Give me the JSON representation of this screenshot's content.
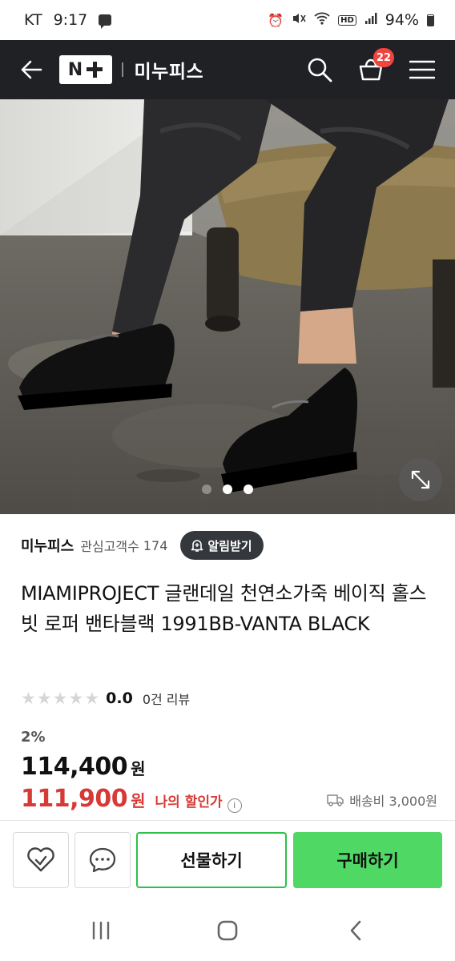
{
  "status_bar": {
    "carrier": "KT",
    "time": "9:17",
    "battery": "94%",
    "icons": [
      "message-icon",
      "alarm-icon",
      "mute-icon",
      "wifi-icon",
      "hd-icon",
      "signal-icon",
      "battery-icon"
    ],
    "hd_label": "HD"
  },
  "header": {
    "logo_text": "N",
    "store_name": "미누피스",
    "cart_count": "22",
    "icons": [
      "back-arrow-icon",
      "search-icon",
      "cart-icon",
      "menu-icon"
    ]
  },
  "hero": {
    "slide_count": 3,
    "active_slide": 1,
    "icons": [
      "expand-icon"
    ]
  },
  "seller": {
    "name": "미누피스",
    "follower_label": "관심고객수",
    "follower_count": "174",
    "alarm_label": "알림받기"
  },
  "product": {
    "title": "MIAMIPROJECT 글랜데일 천연소가죽 베이직 홀스빗 로퍼 밴타블랙 1991BB-VANTA BLACK",
    "rating": "0.0",
    "review_count": "0건 리뷰",
    "stars_filled": 0,
    "stars_total": 5,
    "discount_rate": "2%",
    "original_price": "114,400",
    "sale_price": "111,900",
    "currency": "원",
    "my_discount_label": "나의 할인가",
    "info_glyph": "i",
    "shipping": "배송비 3,000원"
  },
  "action_bar": {
    "gift_label": "선물하기",
    "buy_label": "구매하기",
    "icons": [
      "wishlist-heart-icon",
      "chat-bubble-icon"
    ]
  },
  "colors": {
    "header_bg": "#1f2125",
    "accent_red": "#d63a36",
    "badge_red": "#f0443f",
    "brand_green": "#50d864",
    "gift_border": "#2dc14a"
  }
}
